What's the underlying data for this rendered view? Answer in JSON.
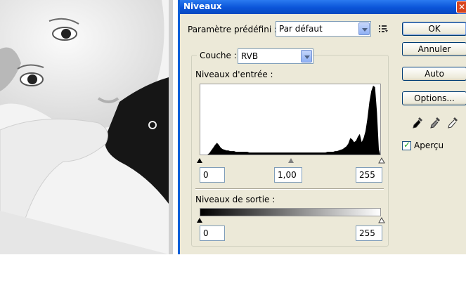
{
  "dialog": {
    "title": "Niveaux",
    "preset_label": "Paramètre prédéfini :",
    "preset_value": "Par défaut",
    "channel_label": "Couche :",
    "channel_value": "RVB",
    "input_levels_label": "Niveaux d'entrée :",
    "input_black": "0",
    "input_gamma": "1,00",
    "input_white": "255",
    "output_levels_label": "Niveaux de sortie :",
    "output_black": "0",
    "output_white": "255",
    "buttons": {
      "ok": "OK",
      "cancel": "Annuler",
      "auto": "Auto",
      "options": "Options..."
    },
    "preview_label": "Aperçu",
    "preview_checked": true
  },
  "histogram": {
    "type": "area",
    "x_range": [
      0,
      255
    ],
    "values": [
      0,
      0,
      0,
      0,
      2,
      6,
      10,
      14,
      17,
      14,
      10,
      8,
      7,
      6,
      6,
      5,
      5,
      5,
      4,
      4,
      4,
      4,
      4,
      4,
      4,
      3,
      3,
      3,
      3,
      3,
      3,
      3,
      3,
      3,
      3,
      3,
      3,
      3,
      3,
      3,
      3,
      3,
      3,
      3,
      3,
      3,
      3,
      3,
      3,
      3,
      3,
      3,
      3,
      3,
      3,
      3,
      3,
      3,
      3,
      3,
      3,
      3,
      3,
      3,
      3,
      3,
      4,
      4,
      4,
      4,
      5,
      5,
      6,
      7,
      8,
      10,
      12,
      16,
      24,
      22,
      18,
      20,
      26,
      30,
      18,
      24,
      34,
      52,
      76,
      92,
      100,
      98,
      62,
      8
    ]
  },
  "colors": {
    "titlebar": "#0a54d8",
    "dialog_bg": "#ece9d8",
    "close": "#d8451e"
  },
  "icons": [
    "options-list-icon",
    "black-eyedropper-icon",
    "gray-eyedropper-icon",
    "white-eyedropper-icon",
    "checkmark-icon",
    "close-icon"
  ]
}
